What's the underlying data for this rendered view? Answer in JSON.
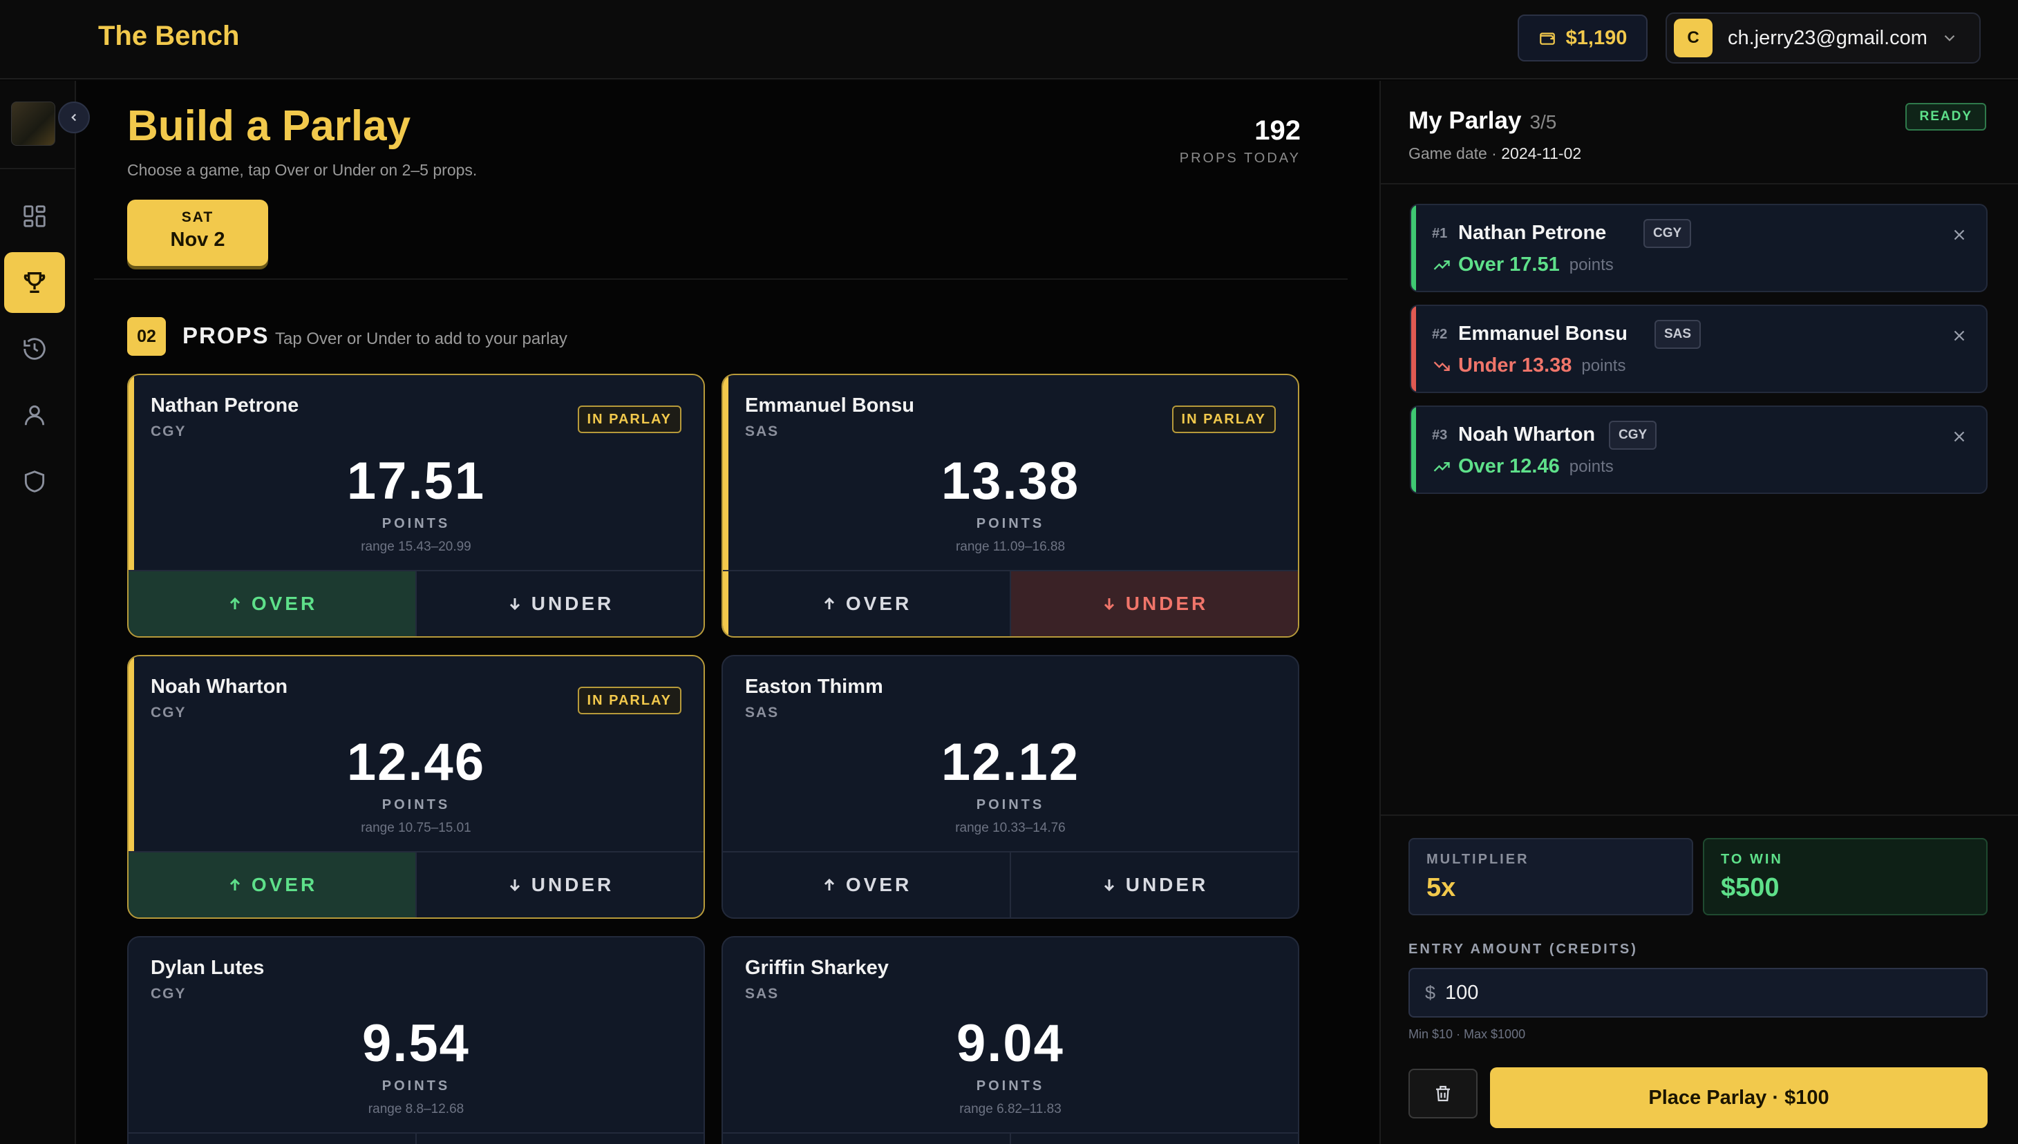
{
  "app": {
    "brand": "The Bench"
  },
  "header": {
    "balance": "$1,190",
    "avatar_initial": "C",
    "email": "ch.jerry23@gmail.com"
  },
  "sidebar": {
    "items": [
      {
        "name": "dashboard",
        "icon": "grid-icon"
      },
      {
        "name": "parlay",
        "icon": "trophy-icon",
        "active": true
      },
      {
        "name": "history",
        "icon": "history-icon"
      },
      {
        "name": "profile",
        "icon": "user-icon"
      },
      {
        "name": "admin",
        "icon": "shield-icon"
      }
    ]
  },
  "page": {
    "title": "Build a Parlay",
    "subtitle": "Choose a game, tap Over or Under on 2–5 props.",
    "props_count": "192",
    "props_count_label": "PROPS TODAY",
    "date": {
      "dow": "SAT",
      "day": "Nov 2"
    },
    "step": "02",
    "section_title": "PROPS",
    "section_hint": "Tap Over or Under to add to your parlay"
  },
  "labels": {
    "in_parlay": "IN PARLAY",
    "over": "OVER",
    "under": "UNDER"
  },
  "props": [
    {
      "name": "Nathan Petrone",
      "team": "CGY",
      "line": "17.51",
      "unit": "POINTS",
      "range": "range 15.43–20.99",
      "selected": "over"
    },
    {
      "name": "Emmanuel Bonsu",
      "team": "SAS",
      "line": "13.38",
      "unit": "POINTS",
      "range": "range 11.09–16.88",
      "selected": "under"
    },
    {
      "name": "Noah Wharton",
      "team": "CGY",
      "line": "12.46",
      "unit": "POINTS",
      "range": "range 10.75–15.01",
      "selected": "over"
    },
    {
      "name": "Easton Thimm",
      "team": "SAS",
      "line": "12.12",
      "unit": "POINTS",
      "range": "range 10.33–14.76",
      "selected": null
    },
    {
      "name": "Dylan Lutes",
      "team": "CGY",
      "line": "9.54",
      "unit": "POINTS",
      "range": "range 8.8–12.68",
      "selected": null
    },
    {
      "name": "Griffin Sharkey",
      "team": "SAS",
      "line": "9.04",
      "unit": "POINTS",
      "range": "range 6.82–11.83",
      "selected": null
    }
  ],
  "parlay": {
    "title": "My Parlay",
    "count": "3/5",
    "date_label": "Game date · ",
    "date": "2024-11-02",
    "status": "READY",
    "legs": [
      {
        "idx": "#1",
        "name": "Nathan Petrone",
        "team": "CGY",
        "pick": "Over 17.51",
        "unit": "points",
        "dir": "over"
      },
      {
        "idx": "#2",
        "name": "Emmanuel Bonsu",
        "team": "SAS",
        "pick": "Under 13.38",
        "unit": "points",
        "dir": "under"
      },
      {
        "idx": "#3",
        "name": "Noah Wharton",
        "team": "CGY",
        "pick": "Over 12.46",
        "unit": "points",
        "dir": "over"
      }
    ],
    "multiplier_label": "MULTIPLIER",
    "multiplier": "5x",
    "to_win_label": "TO WIN",
    "to_win": "$500",
    "entry_label": "ENTRY AMOUNT (CREDITS)",
    "currency": "$",
    "entry_value": "100",
    "limits": "Min $10 · Max $1000",
    "place_label": "Place Parlay · $100"
  },
  "colors": {
    "accent": "#f2c94c",
    "over": "#5ee08a",
    "under": "#f0756a"
  }
}
